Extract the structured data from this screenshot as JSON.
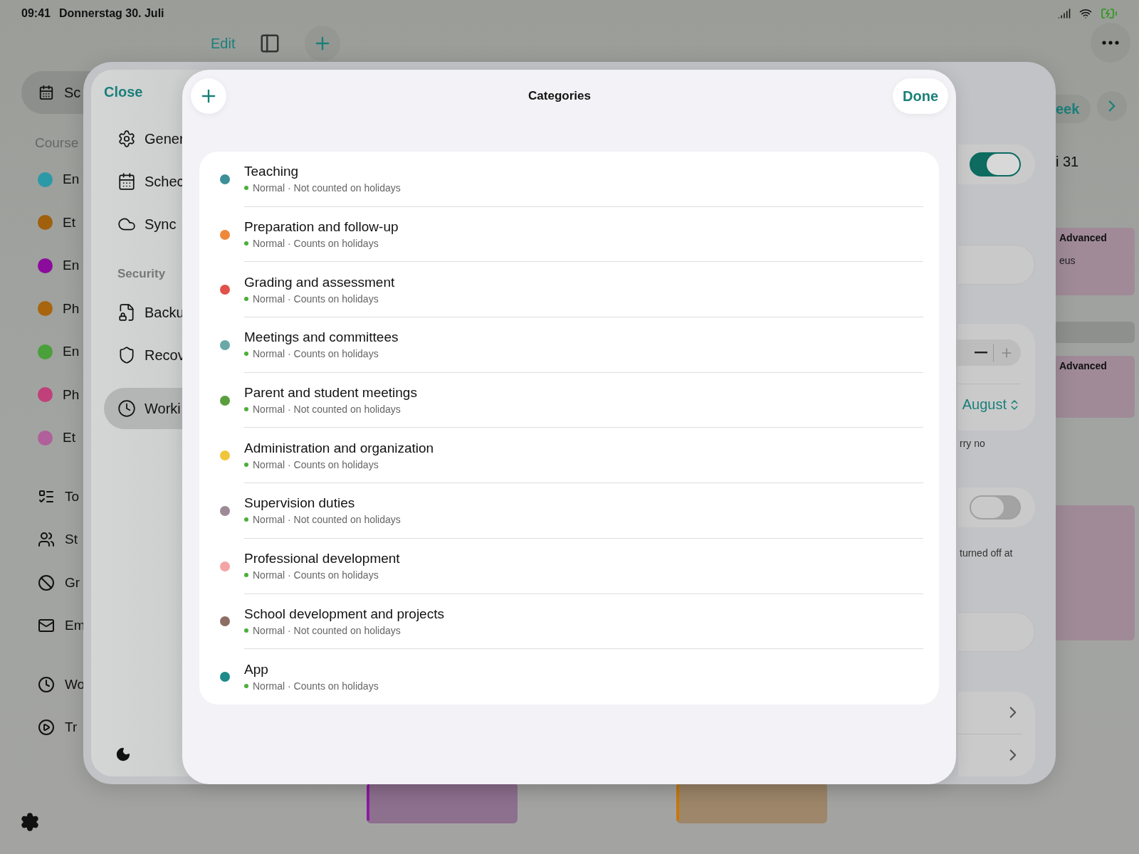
{
  "status_bar": {
    "time": "09:41",
    "date": "Donnerstag 30. Juli"
  },
  "background": {
    "toolbar": {
      "edit": "Edit"
    },
    "sidebar": {
      "top_item": {
        "label": "Sc",
        "selected": true
      },
      "section": "Course",
      "courses": [
        {
          "label": "En",
          "color": "#2b9aa6",
          "selected": false
        },
        {
          "label": "Et",
          "color": "#a0600d",
          "selected": false
        },
        {
          "label": "En",
          "color": "#8b0c9c",
          "selected": false
        },
        {
          "label": "Ph",
          "color": "#a8650d",
          "selected": false
        },
        {
          "label": "En",
          "color": "#4aa03a",
          "selected": false
        },
        {
          "label": "Ph",
          "color": "#c0407a",
          "selected": false
        },
        {
          "label": "Et",
          "color": "#b0609a",
          "selected": false
        }
      ],
      "tools": [
        {
          "label": "To",
          "selected": false
        },
        {
          "label": "St",
          "selected": false
        },
        {
          "label": "Gr",
          "selected": false
        },
        {
          "label": "Em",
          "selected": false
        }
      ],
      "tracking": [
        {
          "label": "Wo",
          "selected": false
        },
        {
          "label": "Tr",
          "selected": false
        }
      ]
    },
    "calendar": {
      "week_button": "eek",
      "day": "i 31",
      "events": [
        {
          "title": "Advanced",
          "subtitle": "eus",
          "color": "#a08a98"
        },
        {
          "color": "#8e908d"
        },
        {
          "title": "Advanced",
          "color": "#a08a98"
        },
        {
          "color": "#a08a98"
        },
        {
          "kind": "accent",
          "color": "#8b1ca0"
        },
        {
          "kind": "accent",
          "color": "#c8780a"
        }
      ]
    }
  },
  "settings": {
    "close": "Close",
    "nav": [
      {
        "kind": "item",
        "label": "Gener",
        "selected": false
      },
      {
        "kind": "item",
        "label": "Schec",
        "selected": false
      },
      {
        "kind": "item",
        "label": "Sync",
        "selected": false
      },
      {
        "kind": "header",
        "label": "Security"
      },
      {
        "kind": "item",
        "label": "Backu",
        "selected": false
      },
      {
        "kind": "item",
        "label": "Recov",
        "selected": false
      },
      {
        "kind": "item",
        "label": "Worki",
        "selected": true
      }
    ],
    "detail": [
      {
        "kind": "toggle",
        "on": true
      },
      {
        "kind": "field"
      },
      {
        "kind": "stepper_picker",
        "picker_value": "August"
      },
      {
        "kind": "note",
        "text": "rry no"
      },
      {
        "kind": "toggle",
        "on": false
      },
      {
        "kind": "note",
        "text": "turned off at"
      },
      {
        "kind": "field"
      },
      {
        "kind": "links",
        "rows": [
          {
            "kind": "link"
          },
          {
            "kind": "link"
          }
        ]
      }
    ]
  },
  "categories": {
    "title": "Categories",
    "done": "Done",
    "items": [
      {
        "name": "Teaching",
        "subtitle": "Normal · Not counted on holidays",
        "color": "#3d8f98"
      },
      {
        "name": "Preparation and follow-up",
        "subtitle": "Normal · Counts on holidays",
        "color": "#f0883a"
      },
      {
        "name": "Grading and assessment",
        "subtitle": "Normal · Counts on holidays",
        "color": "#e0524a"
      },
      {
        "name": "Meetings and committees",
        "subtitle": "Normal · Counts on holidays",
        "color": "#6aa8a8"
      },
      {
        "name": "Parent and student meetings",
        "subtitle": "Normal · Not counted on holidays",
        "color": "#5a9e3e"
      },
      {
        "name": "Administration and organization",
        "subtitle": "Normal · Counts on holidays",
        "color": "#f0c53a"
      },
      {
        "name": "Supervision duties",
        "subtitle": "Normal · Not counted on holidays",
        "color": "#9e8a96"
      },
      {
        "name": "Professional development",
        "subtitle": "Normal · Counts on holidays",
        "color": "#f4a4a4"
      },
      {
        "name": "School development and projects",
        "subtitle": "Normal · Not counted on holidays",
        "color": "#8e6d64"
      },
      {
        "name": "App",
        "subtitle": "Normal · Counts on holidays",
        "color": "#1f8a8a"
      }
    ]
  }
}
